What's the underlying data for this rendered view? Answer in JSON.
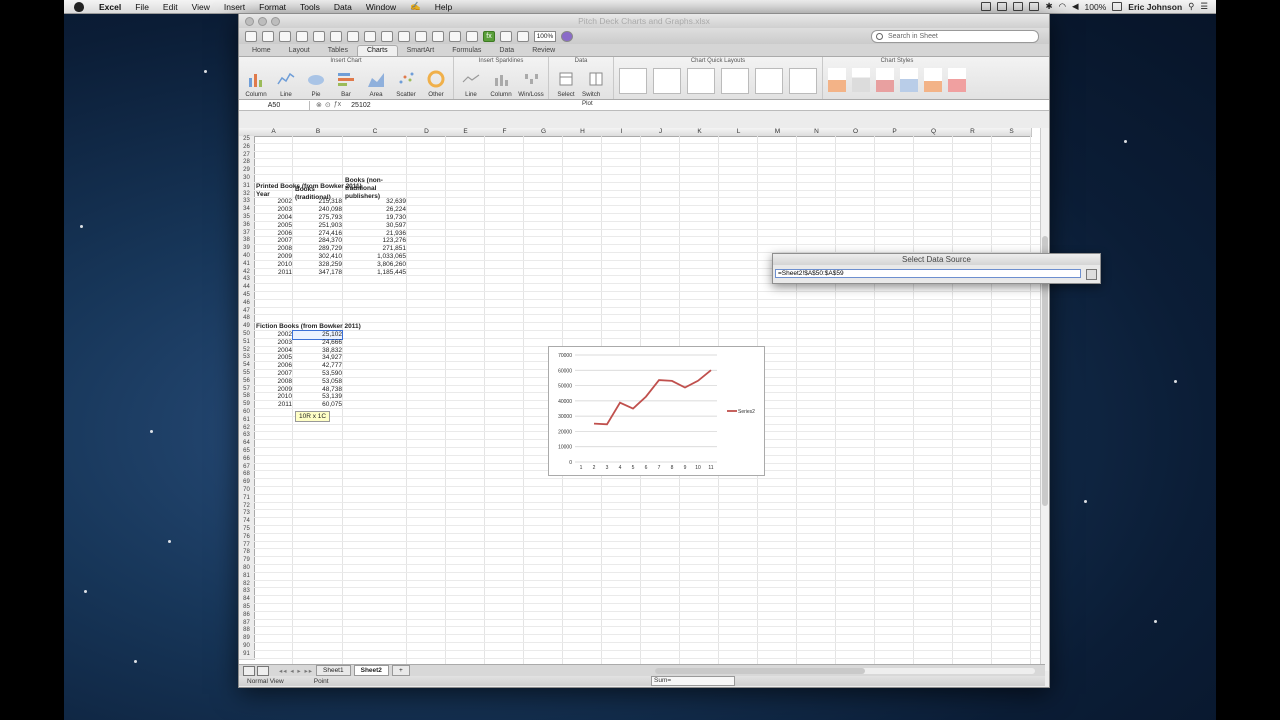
{
  "menubar": {
    "app_name": "Excel",
    "items": [
      "File",
      "Edit",
      "View",
      "Insert",
      "Format",
      "Tools",
      "Data",
      "Window",
      "Help"
    ],
    "status": {
      "battery": "100%",
      "user": "Eric Johnson"
    }
  },
  "window": {
    "title": "Pitch Deck Charts and Graphs.xlsx",
    "zoom": "100%",
    "search_placeholder": "Search in Sheet"
  },
  "ribbon": {
    "tabs": [
      "Home",
      "Layout",
      "Tables",
      "Charts",
      "SmartArt",
      "Formulas",
      "Data",
      "Review"
    ],
    "active_tab": "Charts",
    "groups": {
      "insert_chart": {
        "title": "Insert Chart",
        "buttons": [
          "Column",
          "Line",
          "Pie",
          "Bar",
          "Area",
          "Scatter",
          "Other"
        ]
      },
      "sparklines": {
        "title": "Insert Sparklines",
        "buttons": [
          "Line",
          "Column",
          "Win/Loss"
        ]
      },
      "data": {
        "title": "Data",
        "buttons": [
          "Select",
          "Switch Plot"
        ]
      },
      "quick_layouts": {
        "title": "Chart Quick Layouts"
      },
      "styles": {
        "title": "Chart Styles"
      }
    }
  },
  "formula_bar": {
    "name_box": "A50",
    "value": "25102"
  },
  "columns": [
    "A",
    "B",
    "C",
    "D",
    "E",
    "F",
    "G",
    "H",
    "I",
    "J",
    "K",
    "L",
    "M",
    "N",
    "O",
    "P",
    "Q",
    "R",
    "S"
  ],
  "rows_start": 25,
  "rows_end": 91,
  "printed": {
    "title": "Printed Books (from Bowker 2011)",
    "col_year": "Year",
    "col_trad": "Books (traditional)",
    "col_nontrad": "Books (non-traditional publishers)",
    "rows": [
      [
        "2002",
        "215,318",
        "32,639"
      ],
      [
        "2003",
        "240,098",
        "26,224"
      ],
      [
        "2004",
        "275,793",
        "19,730"
      ],
      [
        "2005",
        "251,903",
        "30,597"
      ],
      [
        "2006",
        "274,416",
        "21,936"
      ],
      [
        "2007",
        "284,370",
        "123,276"
      ],
      [
        "2008",
        "289,729",
        "271,851"
      ],
      [
        "2009",
        "302,410",
        "1,033,065"
      ],
      [
        "2010",
        "328,259",
        "3,806,260"
      ],
      [
        "2011",
        "347,178",
        "1,185,445"
      ]
    ]
  },
  "fiction": {
    "title": "Fiction Books (from Bowker 2011)",
    "rows": [
      [
        "2002",
        "25,102"
      ],
      [
        "2003",
        "24,666"
      ],
      [
        "2004",
        "38,832"
      ],
      [
        "2005",
        "34,927"
      ],
      [
        "2006",
        "42,777"
      ],
      [
        "2007",
        "53,590"
      ],
      [
        "2008",
        "53,058"
      ],
      [
        "2009",
        "48,738"
      ],
      [
        "2010",
        "53,139"
      ],
      [
        "2011",
        "60,075"
      ]
    ]
  },
  "selection_tooltip": "10R x 1C",
  "chart_data": {
    "type": "line",
    "x": [
      1,
      2,
      3,
      4,
      5,
      6,
      7,
      8,
      9,
      10,
      11
    ],
    "series": [
      {
        "name": "Series2",
        "values": [
          null,
          25102,
          24666,
          38832,
          34927,
          42777,
          53590,
          53058,
          48738,
          53139,
          60075
        ]
      }
    ],
    "ylim": [
      0,
      70000
    ],
    "yticks": [
      0,
      10000,
      20000,
      30000,
      40000,
      50000,
      60000,
      70000
    ],
    "grid": true,
    "legend": "right",
    "line_color": "#c0504d"
  },
  "dialog": {
    "title": "Select Data Source",
    "value": "=Sheet2!$A$50:$A$59"
  },
  "sheets": [
    "Sheet1",
    "Sheet2"
  ],
  "active_sheet": "Sheet2",
  "status": {
    "view": "Normal View",
    "mode": "Point",
    "sum": "Sum="
  }
}
